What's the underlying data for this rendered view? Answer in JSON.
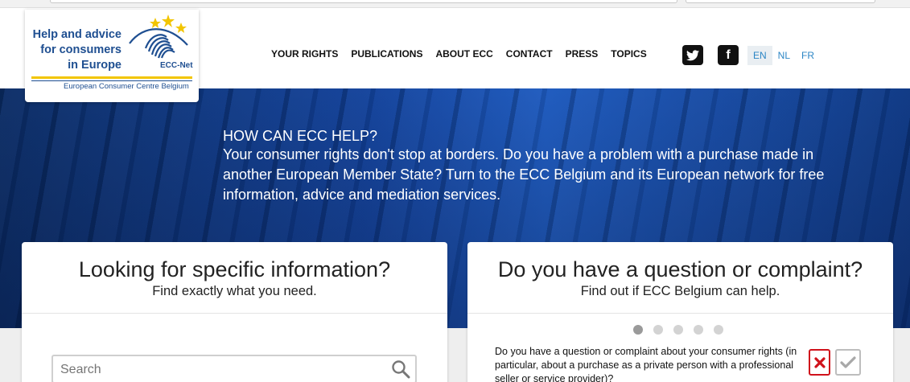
{
  "logo": {
    "line1": "Help and advice",
    "line2": "for consumers",
    "line3": "in Europe",
    "network": "ECC-Net",
    "subtitle": "European Consumer Centre Belgium"
  },
  "nav": {
    "items": [
      "YOUR RIGHTS",
      "PUBLICATIONS",
      "ABOUT ECC",
      "CONTACT",
      "PRESS",
      "TOPICS"
    ]
  },
  "social": {
    "twitter_icon": "twitter-icon",
    "facebook_icon": "facebook-icon",
    "facebook_glyph": "f"
  },
  "languages": {
    "items": [
      "EN",
      "NL",
      "FR"
    ],
    "active": "EN"
  },
  "hero": {
    "title": "HOW CAN ECC HELP?",
    "body": "Your consumer rights don't stop at borders. Do you have a problem with a purchase made in another European Member State? Turn to the ECC Belgium and its European network for free information, advice and mediation services."
  },
  "left_card": {
    "title": "Looking for specific information?",
    "subtitle": "Find exactly what you need.",
    "search_placeholder": "Search"
  },
  "right_card": {
    "title": "Do you have a question or complaint?",
    "subtitle": "Find out if ECC Belgium can help.",
    "question": "Do you have a question or complaint about your consumer rights (in particular, about a purchase as a private person with a professional seller or service provider)?",
    "carousel_count": 5,
    "carousel_active": 1
  },
  "colors": {
    "brand_blue": "#1f4f91",
    "link_blue": "#2c86c5",
    "no_red": "#d0121b",
    "hero_blue": "#1345a3",
    "logo_yellow": "#f2c500"
  }
}
